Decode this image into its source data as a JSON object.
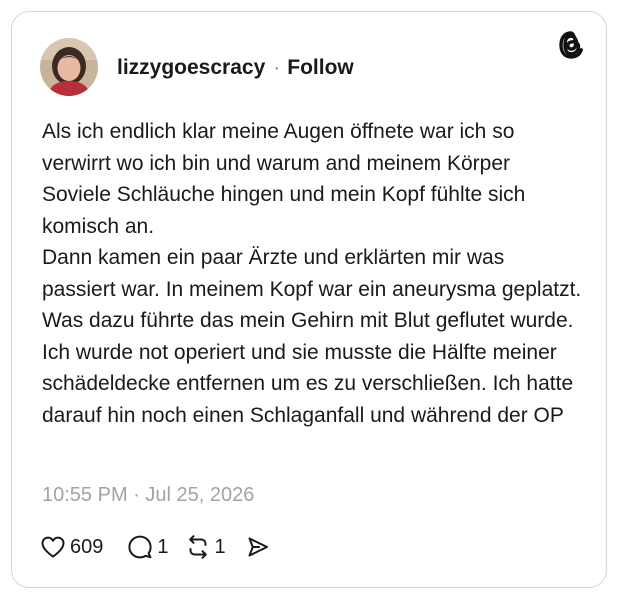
{
  "post": {
    "author": {
      "username": "lizzygoescracy",
      "separator": "·",
      "follow_label": "Follow",
      "avatar_icon": "profile-photo"
    },
    "brand_icon": "threads-logo-icon",
    "text_paragraphs": [
      "Als ich endlich klar meine Augen öffnete war ich so verwirrt wo ich bin und warum and meinem Körper Soviele Schläuche hingen und mein Kopf fühlte sich komisch an.",
      "Dann kamen ein paar Ärzte und erklärten mir was passiert war. In meinem Kopf war ein aneurysma geplatzt. Was dazu führte das mein Gehirn mit Blut geflutet wurde. Ich wurde not operiert und sie musste die Hälfte meiner schädeldecke entfernen um es zu verschließen. Ich hatte darauf hin noch einen Schlaganfall und während der OP"
    ],
    "timestamp": "10:55 PM · Jul 25, 2026",
    "actions": {
      "likes": "609",
      "replies": "1",
      "reposts": "1",
      "like_icon": "heart-icon",
      "reply_icon": "comment-bubble-icon",
      "repost_icon": "repost-icon",
      "share_icon": "send-icon"
    }
  },
  "colors": {
    "text": "#1a1a1a",
    "muted": "#a3a3a3",
    "border": "#d6d6d6",
    "background": "#ffffff"
  }
}
